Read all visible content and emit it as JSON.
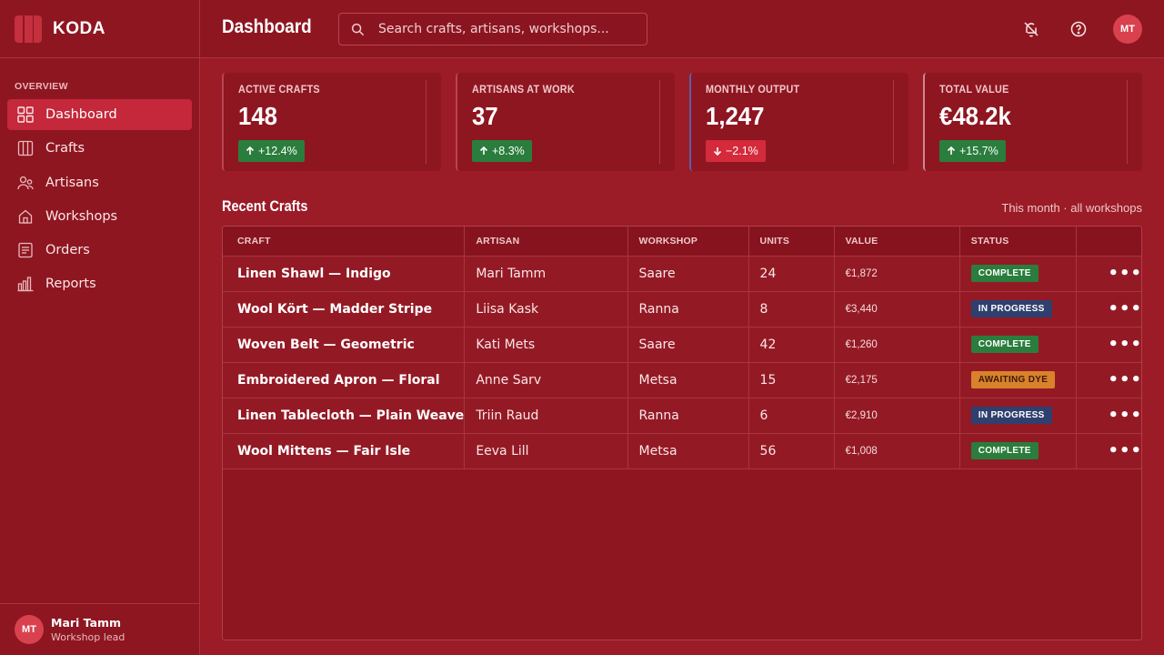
{
  "app": {
    "name": "KODA"
  },
  "sidebar": {
    "section_label": "OVERVIEW",
    "items": [
      {
        "label": "Dashboard",
        "icon": "grid-icon",
        "active": true
      },
      {
        "label": "Crafts",
        "icon": "loom-icon"
      },
      {
        "label": "Artisans",
        "icon": "users-icon"
      },
      {
        "label": "Workshops",
        "icon": "house-icon"
      },
      {
        "label": "Orders",
        "icon": "document-icon"
      },
      {
        "label": "Reports",
        "icon": "bar-chart-icon"
      }
    ],
    "user": {
      "initials": "MT",
      "name": "Mari Tamm",
      "role": "Workshop lead"
    }
  },
  "header": {
    "title": "Dashboard",
    "search_placeholder": "Search crafts, artisans, workshops...",
    "avatar_initials": "MT"
  },
  "kpis": [
    {
      "label": "ACTIVE CRAFTS",
      "value": "148",
      "delta": "+12.4%",
      "direction": "up"
    },
    {
      "label": "ARTISANS AT WORK",
      "value": "37",
      "delta": "+8.3%",
      "direction": "up"
    },
    {
      "label": "MONTHLY OUTPUT",
      "value": "1,247",
      "delta": "−2.1%",
      "direction": "down"
    },
    {
      "label": "TOTAL VALUE",
      "value": "€48.2k",
      "delta": "+15.7%",
      "direction": "up"
    }
  ],
  "recent": {
    "title": "Recent Crafts",
    "meta": "This month · all workshops",
    "columns": [
      "CRAFT",
      "ARTISAN",
      "WORKSHOP",
      "UNITS",
      "VALUE",
      "STATUS",
      ""
    ],
    "rows": [
      {
        "craft": "Linen Shawl — Indigo",
        "artisan": "Mari Tamm",
        "workshop": "Saare",
        "units": "24",
        "value": "€1,872",
        "status": "COMPLETE",
        "status_kind": "complete"
      },
      {
        "craft": "Wool Kört — Madder Stripe",
        "artisan": "Liisa Kask",
        "workshop": "Ranna",
        "units": "8",
        "value": "€3,440",
        "status": "IN PROGRESS",
        "status_kind": "progress"
      },
      {
        "craft": "Woven Belt — Geometric",
        "artisan": "Kati Mets",
        "workshop": "Saare",
        "units": "42",
        "value": "€1,260",
        "status": "COMPLETE",
        "status_kind": "complete"
      },
      {
        "craft": "Embroidered Apron — Floral",
        "artisan": "Anne Sarv",
        "workshop": "Metsa",
        "units": "15",
        "value": "€2,175",
        "status": "AWAITING DYE",
        "status_kind": "awaiting"
      },
      {
        "craft": "Linen Tablecloth — Plain Weave",
        "artisan": "Triin Raud",
        "workshop": "Ranna",
        "units": "6",
        "value": "€2,910",
        "status": "IN PROGRESS",
        "status_kind": "progress"
      },
      {
        "craft": "Wool Mittens — Fair Isle",
        "artisan": "Eeva Lill",
        "workshop": "Metsa",
        "units": "56",
        "value": "€1,008",
        "status": "COMPLETE",
        "status_kind": "complete"
      }
    ]
  },
  "colors": {
    "background": "#9b1b27",
    "panel": "#8e1621",
    "accent": "#c4283a",
    "positive": "#2a7d3c",
    "negative": "#d52a3b",
    "in_progress": "#2f3f6e",
    "awaiting": "#d9822b"
  }
}
